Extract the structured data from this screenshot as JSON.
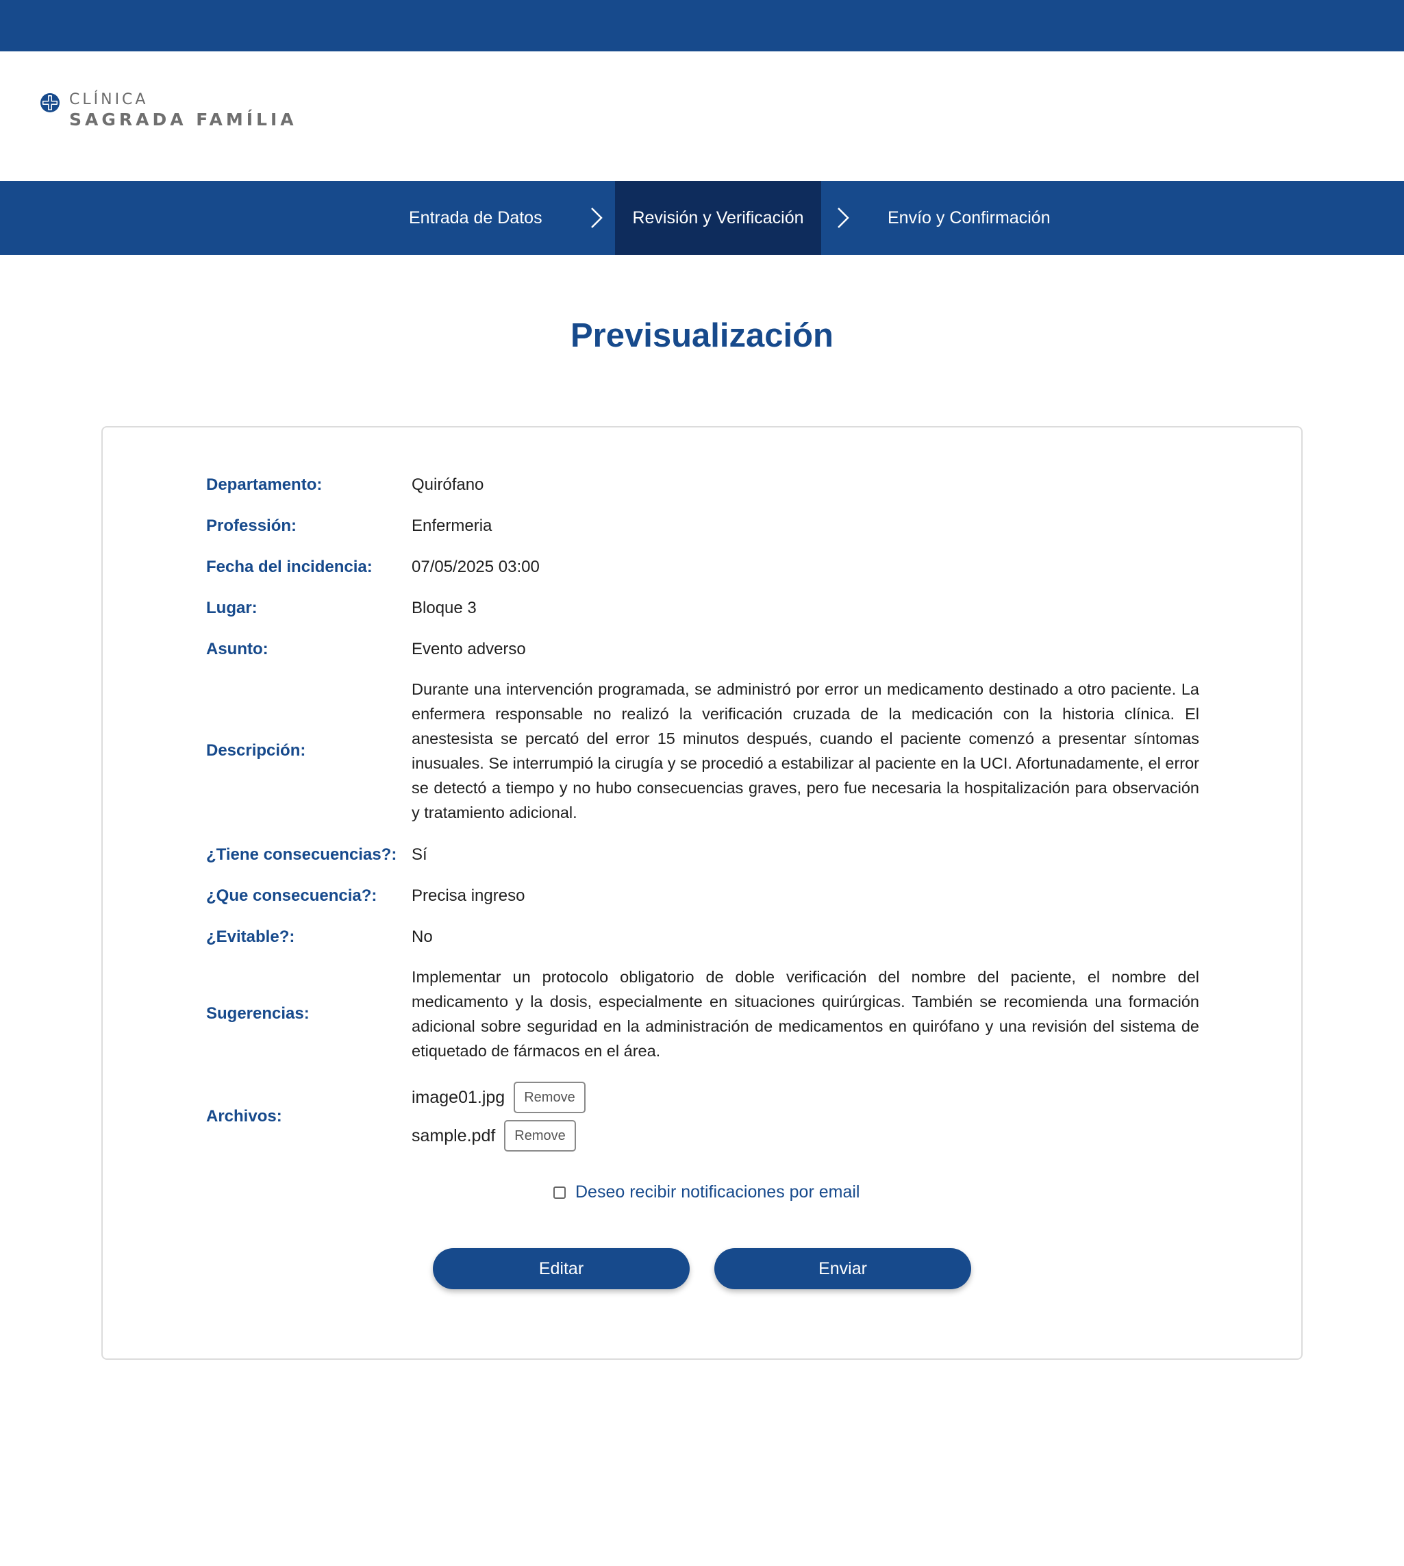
{
  "brand": {
    "line1": "CLÍNICA",
    "line2": "SAGRADA FAMÍLIA",
    "color": "#174a8c"
  },
  "steps": [
    {
      "label": "Entrada de Datos",
      "active": false
    },
    {
      "label": "Revisión y Verificación",
      "active": true
    },
    {
      "label": "Envío y Confirmación",
      "active": false
    }
  ],
  "page": {
    "title": "Previsualización"
  },
  "fields": {
    "departamento": {
      "label": "Departamento:",
      "value": "Quirófano"
    },
    "profession": {
      "label": "Professión:",
      "value": "Enfermeria"
    },
    "fecha": {
      "label": "Fecha del incidencia:",
      "value": "07/05/2025 03:00"
    },
    "lugar": {
      "label": "Lugar:",
      "value": "Bloque 3"
    },
    "asunto": {
      "label": "Asunto:",
      "value": "Evento adverso"
    },
    "descripcion": {
      "label": "Descripción:",
      "value": "Durante una intervención programada, se administró por error un medicamento destinado a otro paciente. La enfermera responsable no realizó la verificación cruzada de la medicación con la historia clínica. El anestesista se percató del error 15 minutos después, cuando el paciente comenzó a presentar síntomas inusuales. Se interrumpió la cirugía y se procedió a estabilizar al paciente en la UCI. Afortunadamente, el error se detectó a tiempo y no hubo consecuencias graves, pero fue necesaria la hospitalización para observación y tratamiento adicional."
    },
    "consecuencias": {
      "label": "¿Tiene consecuencias?:",
      "value": "Sí"
    },
    "que_consecuencia": {
      "label": "¿Que consecuencia?:",
      "value": "Precisa ingreso"
    },
    "evitable": {
      "label": "¿Evitable?:",
      "value": "No"
    },
    "sugerencias": {
      "label": "Sugerencias:",
      "value": "Implementar un protocolo obligatorio de doble verificación del nombre del paciente, el nombre del medicamento y la dosis, especialmente en situaciones quirúrgicas. También se recomienda una formación adicional sobre seguridad en la administración de medicamentos en quirófano y una revisión del sistema de etiquetado de fármacos en el área."
    },
    "archivos": {
      "label": "Archivos:",
      "files": [
        {
          "name": "image01.jpg",
          "action": "Remove"
        },
        {
          "name": "sample.pdf",
          "action": "Remove"
        }
      ]
    }
  },
  "notifications": {
    "label": "Deseo recibir notificaciones por email",
    "checked": false
  },
  "actions": {
    "edit_label": "Editar",
    "send_label": "Enviar"
  },
  "icons": {
    "logo": "cross-logo-icon",
    "step_separator": "chevron-right-icon"
  }
}
